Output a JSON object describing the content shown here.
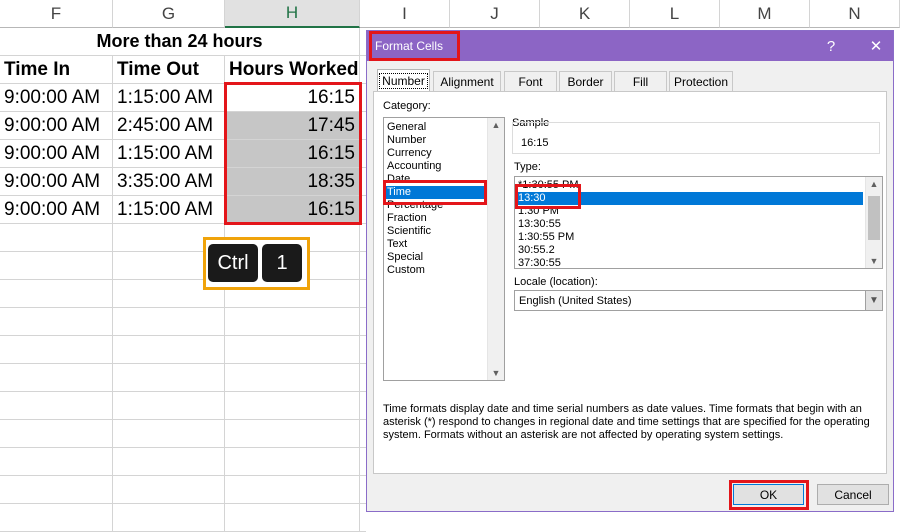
{
  "sheet": {
    "columns": [
      "F",
      "G",
      "H",
      "I",
      "J",
      "K",
      "L",
      "M",
      "N"
    ],
    "title": "More than 24 hours",
    "headers": [
      "Time In",
      "Time Out",
      "Hours Worked"
    ],
    "rows": [
      [
        "9:00:00 AM",
        "1:15:00 AM",
        "16:15"
      ],
      [
        "9:00:00 AM",
        "2:45:00 AM",
        "17:45"
      ],
      [
        "9:00:00 AM",
        "1:15:00 AM",
        "16:15"
      ],
      [
        "9:00:00 AM",
        "3:35:00 AM",
        "18:35"
      ],
      [
        "9:00:00 AM",
        "1:15:00 AM",
        "16:15"
      ]
    ]
  },
  "shortcut": {
    "key1": "Ctrl",
    "key2": "1"
  },
  "dialog": {
    "title": "Format Cells",
    "help": "?",
    "close": "✕",
    "tabs": [
      "Number",
      "Alignment",
      "Font",
      "Border",
      "Fill",
      "Protection"
    ],
    "category_label": "Category:",
    "categories": [
      "General",
      "Number",
      "Currency",
      "Accounting",
      "Date",
      "Time",
      "Percentage",
      "Fraction",
      "Scientific",
      "Text",
      "Special",
      "Custom"
    ],
    "selected_category": "Time",
    "sample_label": "Sample",
    "sample_value": "16:15",
    "type_label": "Type:",
    "types": [
      "*1:30:55 PM",
      "13:30",
      "1:30 PM",
      "13:30:55",
      "1:30:55 PM",
      "30:55.2",
      "37:30:55"
    ],
    "selected_type": "13:30",
    "locale_label": "Locale (location):",
    "locale_value": "English (United States)",
    "description": "Time formats display date and time serial numbers as date values.  Time formats that begin with an asterisk (*) respond to changes in regional date and time settings that are specified for the operating system. Formats without an asterisk are not affected by operating system settings.",
    "ok": "OK",
    "cancel": "Cancel"
  },
  "colors": {
    "accent_red": "#e3151a",
    "title_purple": "#8c65c5",
    "selection_blue": "#0078d7",
    "shortcut_border": "#f0a30a"
  }
}
